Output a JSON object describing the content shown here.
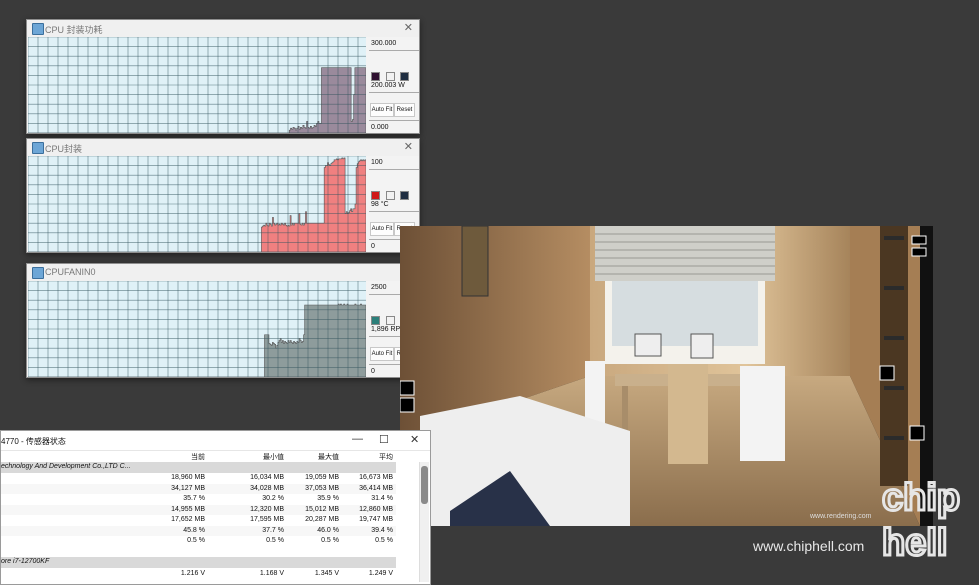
{
  "graphs": [
    {
      "title": "CPU 封装功耗",
      "max_label": "300.000",
      "current": "200.003 W",
      "min_label": "0.000",
      "swatch_fill": "#2e1030",
      "swatch_area": "#f2f2f2",
      "swatch_line": "#1f2d40",
      "fill_color": "#9a8a9c",
      "auto_fit": "Auto Fit",
      "reset": "Reset",
      "history_fraction": [
        0,
        0,
        0,
        0,
        0,
        0,
        0,
        0,
        0,
        0,
        0,
        0,
        0,
        0,
        0,
        0,
        0,
        0,
        0,
        0,
        0,
        0,
        0,
        0,
        0,
        0,
        0,
        0,
        0,
        0,
        0,
        0,
        0,
        0,
        0,
        0,
        0,
        0,
        0,
        0,
        0,
        0,
        0,
        0,
        0,
        0,
        0,
        0,
        0,
        0,
        0,
        0,
        0,
        0,
        0,
        0,
        0,
        0,
        0,
        0,
        0,
        0,
        0,
        0,
        0,
        0,
        0,
        0,
        0,
        0,
        0,
        0,
        0,
        0,
        0,
        0,
        0,
        0,
        0,
        0,
        0,
        0,
        0,
        0,
        0,
        0,
        0,
        0,
        0,
        0,
        0,
        0,
        0,
        0,
        0,
        0,
        0,
        0,
        0,
        0,
        0,
        0,
        0,
        0,
        0,
        0,
        0,
        0,
        0,
        0,
        0,
        0,
        0,
        0,
        0,
        0,
        0,
        0,
        0,
        0,
        0,
        0,
        0,
        0,
        0,
        0,
        0,
        0,
        0,
        0,
        0,
        0,
        0,
        0,
        0,
        0,
        0,
        0,
        0,
        0,
        0,
        0,
        0,
        0,
        0,
        0,
        0,
        0,
        0,
        0,
        0,
        0,
        0,
        0,
        0,
        0,
        0,
        0,
        0,
        0,
        0,
        0,
        0,
        0,
        0,
        0,
        0,
        0,
        0,
        0,
        0,
        0,
        0,
        0,
        0,
        0,
        0,
        0,
        0,
        0,
        0,
        0,
        0,
        0,
        0,
        0,
        0,
        0,
        0,
        0,
        0,
        0,
        0,
        0,
        0,
        0,
        0,
        0,
        0,
        0,
        0,
        0,
        0,
        0,
        0,
        0,
        0,
        0,
        0,
        0,
        0,
        0.03,
        0.05,
        0.04,
        0.06,
        0.05,
        0.03,
        0.05,
        0.07,
        0.04,
        0.06,
        0.05,
        0.08,
        0.06,
        0.05,
        0.12,
        0.06,
        0.05,
        0.07,
        0.05,
        0.06,
        0.08,
        0.07,
        0.1,
        0.12,
        0.1,
        0.1,
        0.68,
        0.68,
        0.68,
        0.68,
        0.68,
        0.68,
        0.68,
        0.68,
        0.68,
        0.68,
        0.68,
        0.68,
        0.68,
        0.68,
        0.68,
        0.68,
        0.68,
        0.68,
        0.68,
        0.68,
        0.68,
        0.68,
        0.68,
        0.68,
        0.12,
        0.14,
        0.4,
        0.68,
        0.68,
        0.68,
        0.68,
        0.68,
        0.68,
        0.68,
        0.68,
        0.68
      ]
    },
    {
      "title": "CPU封装",
      "max_label": "100",
      "current": "98 °C",
      "min_label": "0",
      "swatch_fill": "#d01818",
      "swatch_area": "#f2f2f2",
      "swatch_line": "#1f2d40",
      "fill_color": "#f08080",
      "auto_fit": "Auto Fit",
      "reset": "Reset",
      "history_fraction": [
        0,
        0,
        0,
        0,
        0,
        0,
        0,
        0,
        0,
        0,
        0,
        0,
        0,
        0,
        0,
        0,
        0,
        0,
        0,
        0,
        0,
        0,
        0,
        0,
        0,
        0,
        0,
        0,
        0,
        0,
        0,
        0,
        0,
        0,
        0,
        0,
        0,
        0,
        0,
        0,
        0,
        0,
        0,
        0,
        0,
        0,
        0,
        0,
        0,
        0,
        0,
        0,
        0,
        0,
        0,
        0,
        0,
        0,
        0,
        0,
        0,
        0,
        0,
        0,
        0,
        0,
        0,
        0,
        0,
        0,
        0,
        0,
        0,
        0,
        0,
        0,
        0,
        0,
        0,
        0,
        0,
        0,
        0,
        0,
        0,
        0,
        0,
        0,
        0,
        0,
        0,
        0,
        0,
        0,
        0,
        0,
        0,
        0,
        0,
        0,
        0,
        0,
        0,
        0,
        0,
        0,
        0,
        0,
        0,
        0,
        0,
        0,
        0,
        0,
        0,
        0,
        0,
        0,
        0,
        0,
        0,
        0,
        0,
        0,
        0,
        0,
        0,
        0,
        0,
        0,
        0,
        0,
        0,
        0,
        0,
        0,
        0,
        0,
        0,
        0,
        0,
        0,
        0,
        0,
        0,
        0,
        0,
        0,
        0,
        0,
        0,
        0,
        0,
        0,
        0,
        0,
        0,
        0,
        0,
        0,
        0,
        0,
        0,
        0,
        0,
        0,
        0,
        0,
        0,
        0,
        0,
        0,
        0,
        0,
        0,
        0,
        0,
        0,
        0,
        0,
        0,
        0,
        0,
        0,
        0,
        0,
        0,
        0,
        0,
        0,
        0,
        0,
        0,
        0,
        0,
        0,
        0,
        0,
        0,
        0,
        0,
        0,
        0,
        0,
        0,
        0,
        0,
        0,
        0,
        0,
        0,
        0,
        0.26,
        0.27,
        0.28,
        0.27,
        0.3,
        0.28,
        0.27,
        0.3,
        0.29,
        0.27,
        0.36,
        0.3,
        0.28,
        0.29,
        0.3,
        0.28,
        0.29,
        0.28,
        0.3,
        0.29,
        0.28,
        0.3,
        0.28,
        0.27,
        0.28,
        0.27,
        0.38,
        0.28,
        0.3,
        0.28,
        0.3,
        0.3,
        0.3,
        0.3,
        0.4,
        0.29,
        0.28,
        0.3,
        0.28,
        0.3,
        0.42,
        0.3,
        0.3,
        0.3,
        0.3,
        0.3,
        0.3,
        0.3,
        0.3,
        0.3,
        0.3,
        0.3,
        0.3,
        0.3,
        0.3,
        0.3,
        0.3,
        0.88,
        0.9,
        0.9,
        0.93,
        0.91,
        0.9,
        0.92,
        0.93,
        0.94,
        0.96,
        0.96,
        0.97,
        0.96,
        0.97,
        0.97,
        0.97,
        0.98,
        0.97,
        0.98,
        0.4,
        0.42,
        0.4,
        0.41,
        0.43,
        0.45,
        0.42,
        0.45,
        0.45,
        0.5,
        0.88,
        0.92,
        0.94,
        0.95,
        0.96,
        0.95,
        0.96,
        0.95,
        0.96
      ]
    },
    {
      "title": "CPUFANIN0",
      "max_label": "2500",
      "current": "1,896 RPM",
      "min_label": "0",
      "swatch_fill": "#2b7f7a",
      "swatch_area": "#f2f2f2",
      "swatch_line": "#1f2d40",
      "fill_color": "#8e9c9c",
      "auto_fit": "Auto Fit",
      "reset": "Reset",
      "history_fraction": [
        0,
        0,
        0,
        0,
        0,
        0,
        0,
        0,
        0,
        0,
        0,
        0,
        0,
        0,
        0,
        0,
        0,
        0,
        0,
        0,
        0,
        0,
        0,
        0,
        0,
        0,
        0,
        0,
        0,
        0,
        0,
        0,
        0,
        0,
        0,
        0,
        0,
        0,
        0,
        0,
        0,
        0,
        0,
        0,
        0,
        0,
        0,
        0,
        0,
        0,
        0,
        0,
        0,
        0,
        0,
        0,
        0,
        0,
        0,
        0,
        0,
        0,
        0,
        0,
        0,
        0,
        0,
        0,
        0,
        0,
        0,
        0,
        0,
        0,
        0,
        0,
        0,
        0,
        0,
        0,
        0,
        0,
        0,
        0,
        0,
        0,
        0,
        0,
        0,
        0,
        0,
        0,
        0,
        0,
        0,
        0,
        0,
        0,
        0,
        0,
        0,
        0,
        0,
        0,
        0,
        0,
        0,
        0,
        0,
        0,
        0,
        0,
        0,
        0,
        0,
        0,
        0,
        0,
        0,
        0,
        0,
        0,
        0,
        0,
        0,
        0,
        0,
        0,
        0,
        0,
        0,
        0,
        0,
        0,
        0,
        0,
        0,
        0,
        0,
        0,
        0,
        0,
        0,
        0,
        0,
        0,
        0,
        0,
        0,
        0,
        0,
        0,
        0,
        0,
        0,
        0,
        0,
        0,
        0,
        0,
        0,
        0,
        0,
        0,
        0,
        0,
        0,
        0,
        0,
        0,
        0,
        0,
        0,
        0,
        0,
        0,
        0,
        0,
        0,
        0,
        0,
        0,
        0,
        0,
        0,
        0,
        0,
        0,
        0,
        0,
        0,
        0,
        0,
        0,
        0,
        0,
        0,
        0,
        0,
        0,
        0,
        0,
        0,
        0,
        0,
        0,
        0,
        0,
        0,
        0,
        0,
        0,
        0.44,
        0.44,
        0.44,
        0.44,
        0.35,
        0.34,
        0.33,
        0.36,
        0.35,
        0.34,
        0.3,
        0.33,
        0.36,
        0.38,
        0.4,
        0.36,
        0.38,
        0.35,
        0.37,
        0.36,
        0.35,
        0.38,
        0.36,
        0.38,
        0.36,
        0.35,
        0.37,
        0.36,
        0.35,
        0.37,
        0.36,
        0.4,
        0.38,
        0.36,
        0.37,
        0.44,
        0.75,
        0.75,
        0.75,
        0.75,
        0.75,
        0.75,
        0.75,
        0.75,
        0.75,
        0.75,
        0.75,
        0.75,
        0.75,
        0.75,
        0.75,
        0.75,
        0.75,
        0.75,
        0.75,
        0.75,
        0.75,
        0.75,
        0.75,
        0.75,
        0.75,
        0.75,
        0.75,
        0.75,
        0.75,
        0.75,
        0.76,
        0.75,
        0.76,
        0.75,
        0.75,
        0.76,
        0.75,
        0.75,
        0.76,
        0.75,
        0.75,
        0.75,
        0.75,
        0.75,
        0.75,
        0.76,
        0.75,
        0.75,
        0.75,
        0.75,
        0.76,
        0.75,
        0.75,
        0.75,
        0.75
      ]
    }
  ],
  "sensor_window": {
    "title": "4770 - 传感器状态",
    "columns": {
      "current": "当前",
      "min": "最小值",
      "max": "最大值",
      "avg": "平均"
    },
    "rows": [
      {
        "group": "echnology And Development Co.,LTD C..."
      },
      {
        "current": "18,960 MB",
        "min": "16,034 MB",
        "max": "19,059 MB",
        "avg": "16,673 MB"
      },
      {
        "current": "34,127 MB",
        "min": "34,028 MB",
        "max": "37,053 MB",
        "avg": "36,414 MB"
      },
      {
        "current": "35.7 %",
        "min": "30.2 %",
        "max": "35.9 %",
        "avg": "31.4 %"
      },
      {
        "current": "14,955 MB",
        "min": "12,320 MB",
        "max": "15,012 MB",
        "avg": "12,860 MB"
      },
      {
        "current": "17,652 MB",
        "min": "17,595 MB",
        "max": "20,287 MB",
        "avg": "19,747 MB"
      },
      {
        "current": "45.8 %",
        "min": "37.7 %",
        "max": "46.0 %",
        "avg": "39.4 %"
      },
      {
        "current": "0.5 %",
        "min": "0.5 %",
        "max": "0.5 %",
        "avg": "0.5 %"
      },
      {
        "blank": ""
      },
      {
        "group": "ore i7-12700KF"
      },
      {
        "current": "1.216 V",
        "min": "1.168 V",
        "max": "1.345 V",
        "avg": "1.249 V"
      }
    ]
  },
  "watermark": {
    "url": "www.chiphell.com",
    "logo_top": "chip",
    "logo_bottom": "hell",
    "photo_credit": "www.rendering.com"
  }
}
